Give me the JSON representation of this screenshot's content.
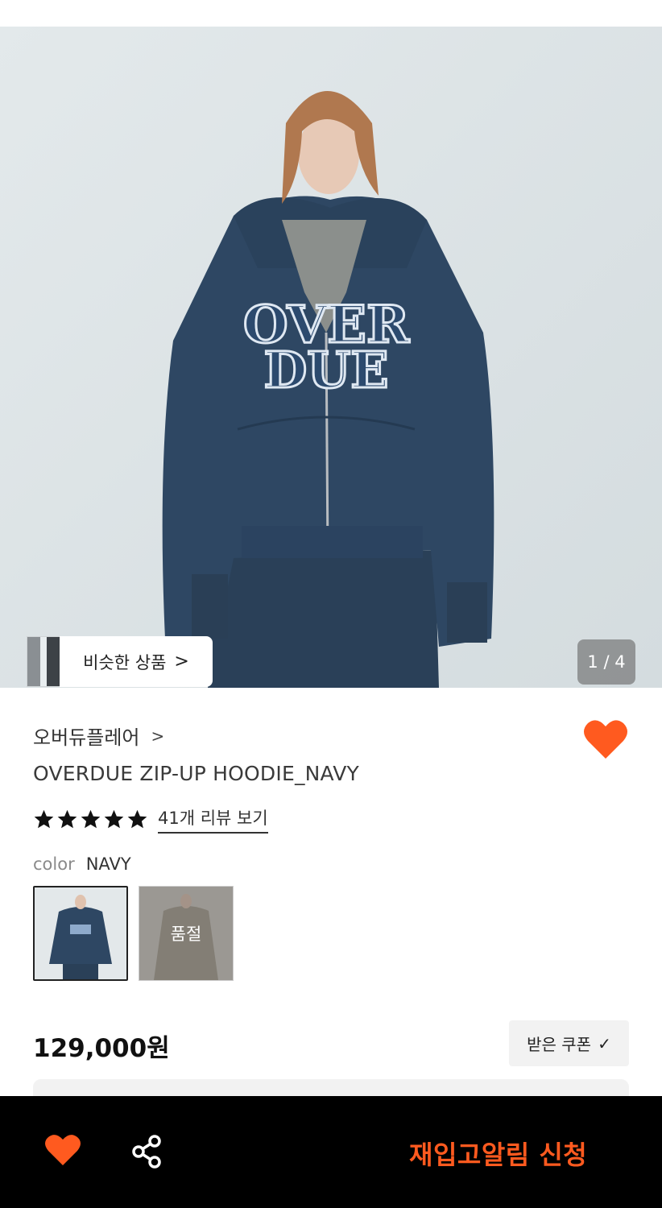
{
  "gallery": {
    "similar_label": "비슷한 상품",
    "similar_chevron": ">",
    "pager": "1 / 4",
    "hoodie_print_line1": "OVER",
    "hoodie_print_line2": "DUE"
  },
  "product": {
    "brand": "오버듀플레어",
    "brand_chevron": ">",
    "name": "OVERDUE ZIP-UP HOODIE_NAVY",
    "rating": 5,
    "review_link": "41개 리뷰 보기",
    "color_label": "color",
    "color_value": "NAVY",
    "swatches": [
      {
        "status": ""
      },
      {
        "status": "품절"
      }
    ],
    "price": "129,000원",
    "coupon_label": "받은 쿠폰",
    "coupon_check": "✓"
  },
  "bottom_bar": {
    "restock_label": "재입고알림 신청"
  },
  "colors": {
    "accent": "#ff5a1f",
    "navy": "#2c4560",
    "bar": "#000000"
  },
  "icons": [
    "heart-icon",
    "share-icon",
    "star-icon",
    "chevron-right-icon",
    "check-icon"
  ]
}
